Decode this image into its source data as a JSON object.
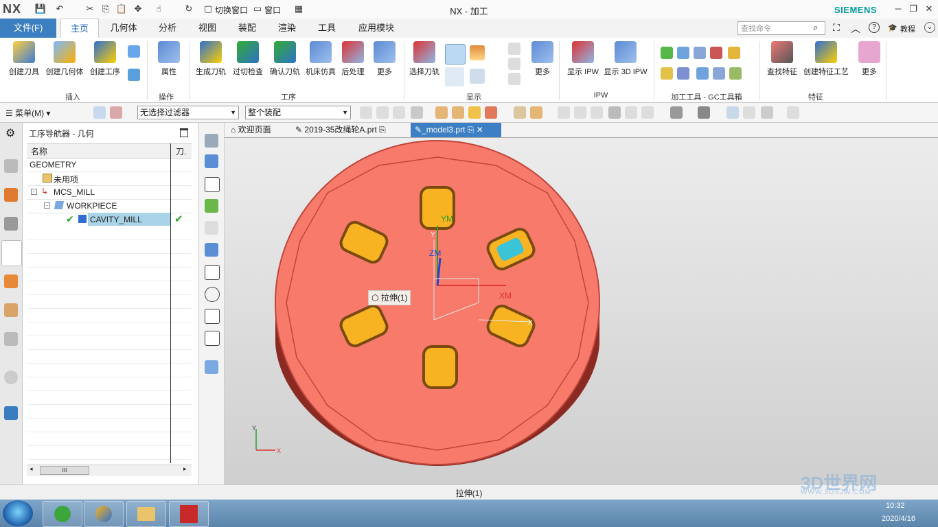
{
  "window": {
    "logo": "NX",
    "title": "NX - 加工",
    "brand": "SIEMENS",
    "switch_window": "切换窗口",
    "window_menu": "窗口"
  },
  "ribbon_tabs": {
    "file": "文件(F)",
    "tabs": [
      "主页",
      "几何体",
      "分析",
      "视图",
      "装配",
      "渲染",
      "工具",
      "应用模块"
    ],
    "active": "主页"
  },
  "search": {
    "placeholder": "查找命令"
  },
  "help": {
    "tutorial": "教程"
  },
  "ribbon": {
    "insert": [
      "创建刀具",
      "创建几何体",
      "创建工序"
    ],
    "operate": [
      "属性"
    ],
    "operations": [
      "生成刀轨",
      "过切检查",
      "确认刀轨",
      "机床仿真",
      "后处理",
      "更多"
    ],
    "display": [
      "选择刀轨",
      "更多"
    ],
    "ipw": [
      "显示 IPW",
      "显示 3D IPW"
    ],
    "feature": [
      "查找特征",
      "创建特征工艺",
      "更多"
    ],
    "groups": {
      "insert": "插入",
      "operate": "操作",
      "operations": "工序",
      "display": "显示",
      "ipw": "IPW",
      "gc": "加工工具 - GC工具箱",
      "feature": "特征"
    }
  },
  "toolbar2": {
    "menu": "菜单(M)",
    "filter": "无选择过滤器",
    "assembly": "整个装配"
  },
  "navigator": {
    "title": "工序导航器 - 几何",
    "col_name": "名称",
    "col_tool": "刀.",
    "rows": [
      {
        "label": "GEOMETRY"
      },
      {
        "label": "未用项"
      },
      {
        "label": "MCS_MILL"
      },
      {
        "label": "WORKPIECE"
      },
      {
        "label": "CAVITY_MILL"
      }
    ],
    "scroll_thumb": "III"
  },
  "doc_tabs": [
    "欢迎页面",
    "2019-35改绳轮A.prt",
    "_model3.prt"
  ],
  "viewport": {
    "tooltip": "拉伸(1)",
    "labels": {
      "ym": "YM",
      "zm": "ZM",
      "xm": "XM",
      "x_small": "X",
      "y_small": "Y",
      "y_triad": "Y",
      "x_triad": "X"
    }
  },
  "status": {
    "text": "拉伸(1)"
  },
  "tray": {
    "time": "10:32",
    "date": "2020/4/16"
  },
  "watermark": {
    "text": "3D世界网",
    "url": "WWW.3DSJW.COM"
  },
  "colors": {
    "part": "#f77a6b",
    "pocket": "#f7b321",
    "accent": "#3b7fc0",
    "brand": "#009999"
  }
}
